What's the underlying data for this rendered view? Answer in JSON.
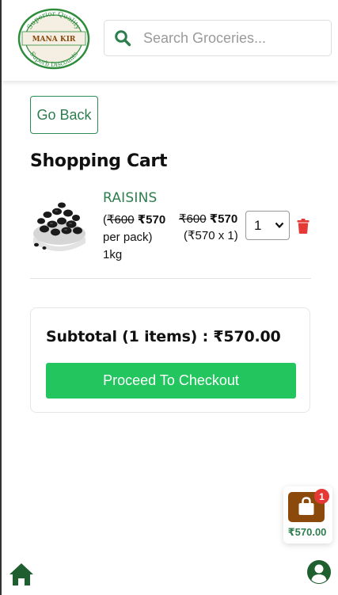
{
  "header": {
    "logo": {
      "top_text": "Superior Quality",
      "center_text": "MANA KIR",
      "bottom_text": "Superb Discounts"
    },
    "search": {
      "placeholder": "Search Groceries...",
      "value": ""
    }
  },
  "nav": {
    "go_back_label": "Go Back"
  },
  "cart": {
    "title": "Shopping Cart",
    "items": [
      {
        "name": "RAISINS",
        "mrp": "₹600",
        "price": "₹570",
        "unit_open": "(",
        "unit_suffix": "per pack)",
        "weight": "1kg",
        "total_mrp": "₹600",
        "total_price": "₹570",
        "total_calc": "(₹570 x 1)",
        "quantity": "1"
      }
    ]
  },
  "summary": {
    "subtotal_text": "Subtotal (1 items) : ₹570.00",
    "checkout_label": "Proceed To Checkout"
  },
  "floating_cart": {
    "count": "1",
    "total": "₹570.00"
  },
  "icons": {
    "search": "search-icon",
    "delete": "trash-icon",
    "bag": "shopping-bag-icon",
    "home": "home-icon",
    "account": "user-icon"
  },
  "colors": {
    "brand_green": "#2e7d4f",
    "checkout_green": "#22c55e",
    "bag_brown": "#8b4a0c",
    "badge_red": "#e53935",
    "trash_red": "#e53935"
  }
}
